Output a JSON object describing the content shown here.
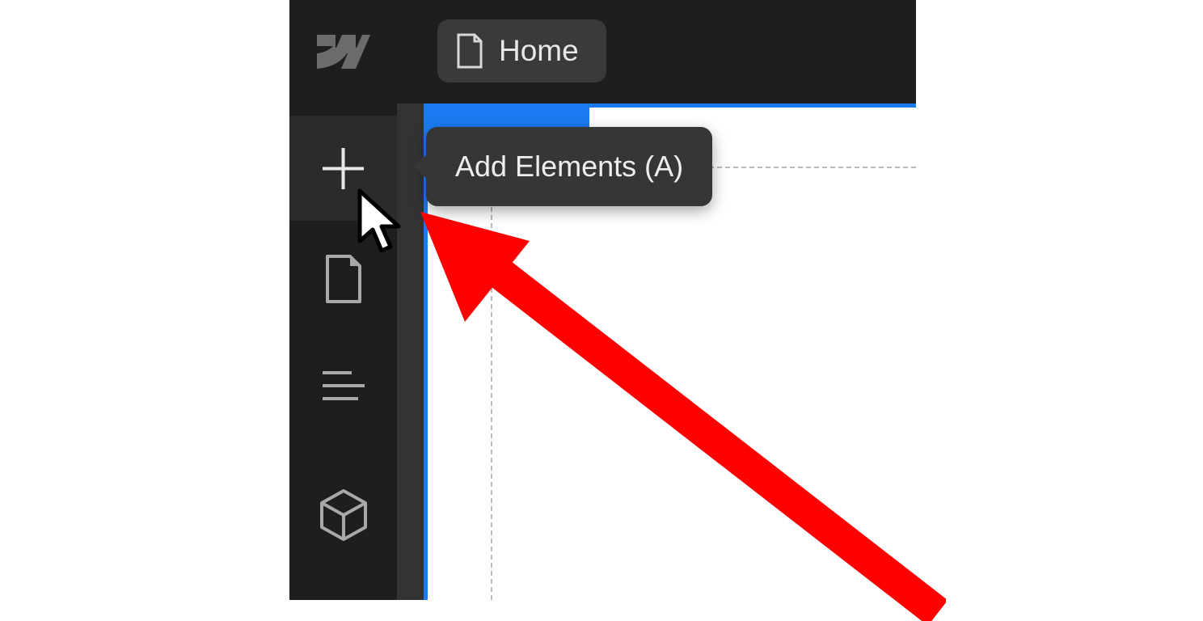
{
  "header": {
    "page_label": "Home"
  },
  "sidebar": {
    "items": [
      {
        "name": "add-elements",
        "tooltip": "Add Elements (A)"
      },
      {
        "name": "pages",
        "tooltip": "Pages"
      },
      {
        "name": "navigator",
        "tooltip": "Navigator"
      },
      {
        "name": "assets",
        "tooltip": "Assets"
      }
    ]
  },
  "tooltip": {
    "text": "Add Elements (A)"
  },
  "colors": {
    "accent": "#1a7bf0",
    "annotation": "#ff0000",
    "panel_bg": "#1e1e1e",
    "tooltip_bg": "#363636"
  }
}
